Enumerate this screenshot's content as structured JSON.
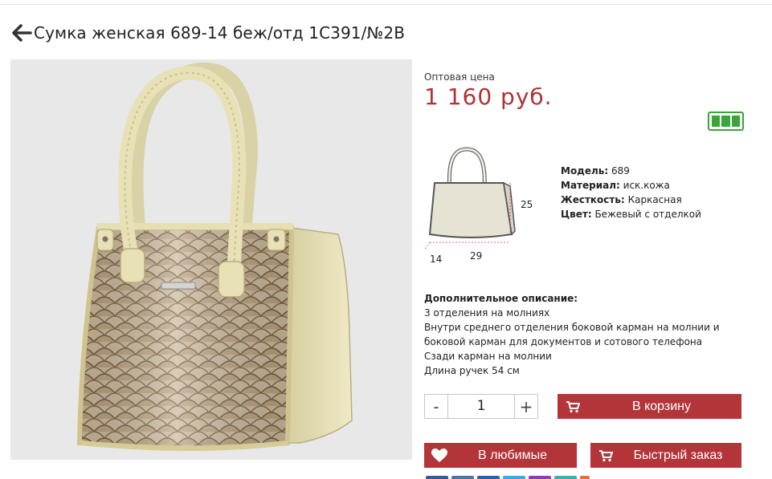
{
  "product": {
    "title": "Сумка женская 689-14 беж/отд 1С391/№2В"
  },
  "price": {
    "label": "Оптовая цена",
    "value": "1 160 руб."
  },
  "stock": {
    "icon": "battery-full-icon",
    "color": "#3aa63a",
    "bars": 3
  },
  "dimensions": {
    "height": "25",
    "depth": "14",
    "width": "29"
  },
  "properties": [
    {
      "label": "Модель:",
      "value": "689"
    },
    {
      "label": "Материал:",
      "value": "иск.кожа"
    },
    {
      "label": "Жесткость:",
      "value": "Каркасная"
    },
    {
      "label": "Цвет:",
      "value": "Бежевый с отделкой"
    }
  ],
  "description": {
    "title": "Дополнительное описание:",
    "lines": [
      "3 отделения на молниях",
      "Внутри среднего отделения боковой карман на молнии и",
      "боковой карман для документов и сотового телефона",
      "Сзади карман на молнии",
      "Длина ручек 54 см"
    ]
  },
  "quantity": {
    "minus_label": "-",
    "value": "1",
    "plus_label": "+"
  },
  "buttons": {
    "cart": "В корзину",
    "favorites": "В любимые",
    "quick_order": "Быстрый заказ"
  },
  "colors": {
    "accent": "#b3353a",
    "price": "#b03236",
    "stock": "#3aa63a"
  }
}
